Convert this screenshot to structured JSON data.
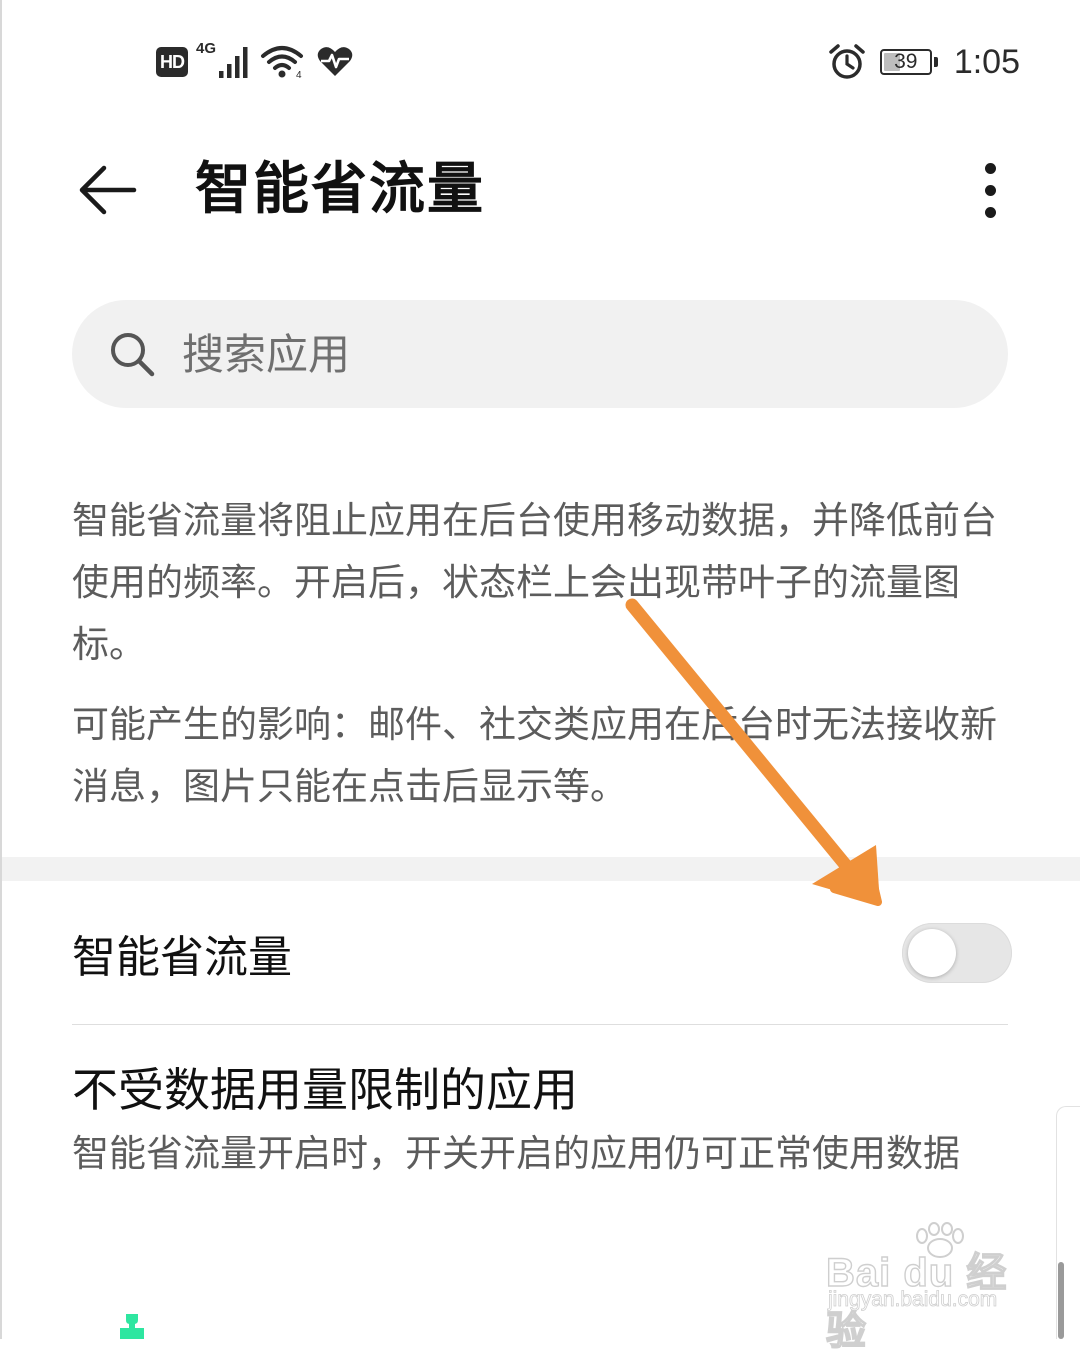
{
  "status_bar": {
    "hd_label": "HD",
    "network_type": "4G",
    "battery_level": "39",
    "battery_fraction": 0.39,
    "time": "1:05",
    "icons": [
      "hd-icon",
      "signal-icon",
      "wifi-icon",
      "health-heart-icon",
      "alarm-icon",
      "battery-icon"
    ]
  },
  "header": {
    "title": "智能省流量",
    "back_icon": "back-arrow-icon",
    "more_icon": "more-vertical-icon"
  },
  "search": {
    "placeholder": "搜索应用",
    "value": "",
    "icon": "search-icon"
  },
  "description": {
    "text": "智能省流量将阻止应用在后台使用移动数据，并降低前台使用的频率。开启后，状态栏上会出现带叶子的流量图标。",
    "impact": "可能产生的影响：邮件、社交类应用在后台时无法接收新消息，图片只能在点击后显示等。"
  },
  "smart_saver": {
    "label": "智能省流量",
    "enabled": false
  },
  "unrestricted_apps": {
    "title": "不受数据用量限制的应用",
    "subtitle": "智能省流量开启时，开关开启的应用仍可正常使用数据"
  },
  "watermark": {
    "logo_text": "Bai du 经验",
    "url": "jingyan.baidu.com"
  },
  "colors": {
    "annotation_arrow": "#f0913a",
    "switch_off_track": "#e6e6e6",
    "secondary_text": "#5c5c5c",
    "search_background": "#f1f1f1",
    "app_icon_green": "#2ee6a0"
  }
}
